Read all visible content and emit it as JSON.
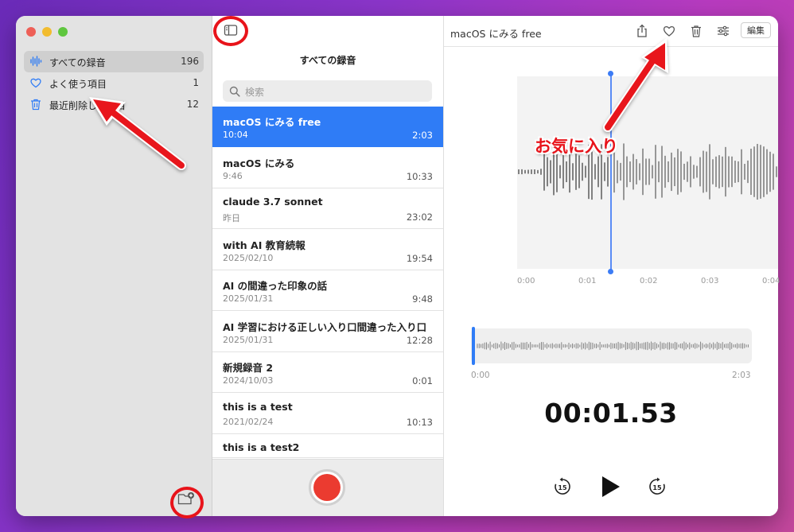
{
  "sidebar": {
    "items": [
      {
        "label": "すべての録音",
        "count": "196",
        "icon": "waveform-icon"
      },
      {
        "label": "よく使う項目",
        "count": "1",
        "icon": "heart-icon"
      },
      {
        "label": "最近削除した項目",
        "count": "12",
        "icon": "trash-icon"
      }
    ]
  },
  "list": {
    "title": "すべての録音",
    "search_placeholder": "検索",
    "recordings": [
      {
        "title": "macOS にみる free",
        "date": "10:04",
        "length": "2:03",
        "selected": true
      },
      {
        "title": "macOS にみる",
        "date": "9:46",
        "length": "10:33"
      },
      {
        "title": "claude 3.7 sonnet",
        "date": "昨日",
        "length": "23:02"
      },
      {
        "title": "with AI 教育続報",
        "date": "2025/02/10",
        "length": "19:54"
      },
      {
        "title": "AI の間違った印象の話",
        "date": "2025/01/31",
        "length": "9:48"
      },
      {
        "title": "AI 学習における正しい入り口間違った入り口",
        "date": "2025/01/31",
        "length": "12:28"
      },
      {
        "title": "新規録音 2",
        "date": "2024/10/03",
        "length": "0:01"
      },
      {
        "title": "this is a test",
        "date": "2021/02/24",
        "length": "10:13"
      },
      {
        "title": "this is a test2",
        "date": "",
        "length": ""
      }
    ]
  },
  "detail": {
    "title": "macOS にみる free",
    "edit_label": "編集",
    "timeline": [
      "0:00",
      "0:01",
      "0:02",
      "0:03",
      "0:04"
    ],
    "overview_start": "0:00",
    "overview_end": "2:03",
    "elapsed": "00:01.53",
    "playhead_fraction": 0.0124
  },
  "annotation": {
    "favorites_label": "お気に入り",
    "color": "#e8131a"
  },
  "colors": {
    "accent": "#2f7cf6",
    "record": "#eb3b30"
  }
}
